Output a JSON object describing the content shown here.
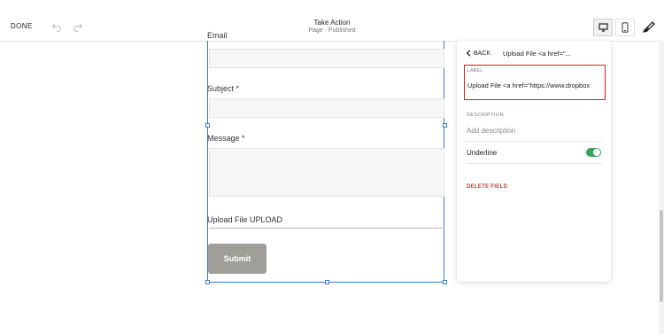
{
  "topbar": {
    "done_label": "DONE",
    "page_title": "Take Action",
    "page_status": "Page · Published",
    "icons": [
      "undo-icon",
      "redo-icon",
      "desktop-icon",
      "mobile-icon",
      "paintbrush-icon"
    ]
  },
  "form": {
    "partial_label": "Email",
    "fields": [
      {
        "label": "Subject *"
      },
      {
        "label": "Message *"
      },
      {
        "label": "Upload File UPLOAD"
      }
    ],
    "submit_label": "Submit"
  },
  "panel": {
    "back_label": "BACK",
    "title": "Upload File <a href=\"...",
    "label_caption": "LABEL",
    "label_value": "Upload File <a href=\"https://www.dropbox",
    "description_caption": "DESCRIPTION",
    "description_placeholder": "Add description",
    "underline_label": "Underline",
    "underline_on": true,
    "delete_label": "DELETE FIELD"
  },
  "colors": {
    "accent_blue": "#3a7bd5",
    "highlight_red": "#e0191e",
    "toggle_green": "#3aa35a",
    "delete_red": "#d0352f",
    "submit_gray": "#a09e99"
  }
}
